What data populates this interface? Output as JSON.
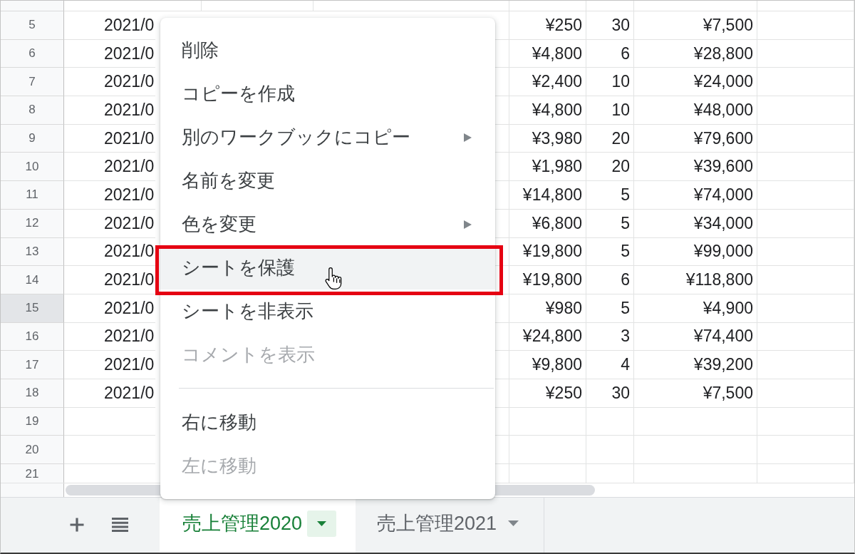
{
  "sheet": {
    "rows": [
      {
        "number": "5",
        "selected": false,
        "cells": [
          "2021/0",
          "¥250",
          "30",
          "¥7,500"
        ]
      },
      {
        "number": "6",
        "selected": false,
        "cells": [
          "2021/0",
          "¥4,800",
          "6",
          "¥28,800"
        ]
      },
      {
        "number": "7",
        "selected": false,
        "cells": [
          "2021/0",
          "¥2,400",
          "10",
          "¥24,000"
        ]
      },
      {
        "number": "8",
        "selected": false,
        "cells": [
          "2021/0",
          "¥4,800",
          "10",
          "¥48,000"
        ]
      },
      {
        "number": "9",
        "selected": false,
        "cells": [
          "2021/0",
          "¥3,980",
          "20",
          "¥79,600"
        ]
      },
      {
        "number": "10",
        "selected": false,
        "cells": [
          "2021/0",
          "¥1,980",
          "20",
          "¥39,600"
        ]
      },
      {
        "number": "11",
        "selected": false,
        "cells": [
          "2021/0",
          "¥14,800",
          "5",
          "¥74,000"
        ]
      },
      {
        "number": "12",
        "selected": false,
        "cells": [
          "2021/0",
          "¥6,800",
          "5",
          "¥34,000"
        ]
      },
      {
        "number": "13",
        "selected": false,
        "cells": [
          "2021/0",
          "¥19,800",
          "5",
          "¥99,000"
        ]
      },
      {
        "number": "14",
        "selected": false,
        "cells": [
          "2021/0",
          "¥19,800",
          "6",
          "¥118,800"
        ]
      },
      {
        "number": "15",
        "selected": true,
        "cells": [
          "2021/0",
          "¥980",
          "5",
          "¥4,900"
        ]
      },
      {
        "number": "16",
        "selected": false,
        "cells": [
          "2021/0",
          "¥24,800",
          "3",
          "¥74,400"
        ]
      },
      {
        "number": "17",
        "selected": false,
        "cells": [
          "2021/0",
          "¥9,800",
          "4",
          "¥39,200"
        ]
      },
      {
        "number": "18",
        "selected": false,
        "cells": [
          "2021/0",
          "¥250",
          "30",
          "¥7,500"
        ]
      },
      {
        "number": "19",
        "selected": false
      },
      {
        "number": "20",
        "selected": false
      },
      {
        "number": "21",
        "selected": false
      }
    ]
  },
  "context_menu": {
    "items": [
      {
        "kind": "item",
        "label": "削除",
        "disabled": false,
        "submenu": false,
        "hovered": false,
        "marked": false
      },
      {
        "kind": "item",
        "label": "コピーを作成",
        "disabled": false,
        "submenu": false,
        "hovered": false,
        "marked": false
      },
      {
        "kind": "item",
        "label": "別のワークブックにコピー",
        "disabled": false,
        "submenu": true,
        "hovered": false,
        "marked": false
      },
      {
        "kind": "item",
        "label": "名前を変更",
        "disabled": false,
        "submenu": false,
        "hovered": false,
        "marked": false
      },
      {
        "kind": "item",
        "label": "色を変更",
        "disabled": false,
        "submenu": true,
        "hovered": false,
        "marked": false
      },
      {
        "kind": "item",
        "label": "シートを保護",
        "disabled": false,
        "submenu": false,
        "hovered": true,
        "marked": true
      },
      {
        "kind": "item",
        "label": "シートを非表示",
        "disabled": false,
        "submenu": false,
        "hovered": false,
        "marked": false
      },
      {
        "kind": "item",
        "label": "コメントを表示",
        "disabled": true,
        "submenu": false,
        "hovered": false,
        "marked": false
      },
      {
        "kind": "separator"
      },
      {
        "kind": "item",
        "label": "右に移動",
        "disabled": false,
        "submenu": false,
        "hovered": false,
        "marked": false
      },
      {
        "kind": "item",
        "label": "左に移動",
        "disabled": true,
        "submenu": false,
        "hovered": false,
        "marked": false
      }
    ]
  },
  "sheet_tabs": {
    "tabs": [
      {
        "label": "売上管理2020",
        "selected": true
      },
      {
        "label": "売上管理2021",
        "selected": false
      }
    ]
  }
}
